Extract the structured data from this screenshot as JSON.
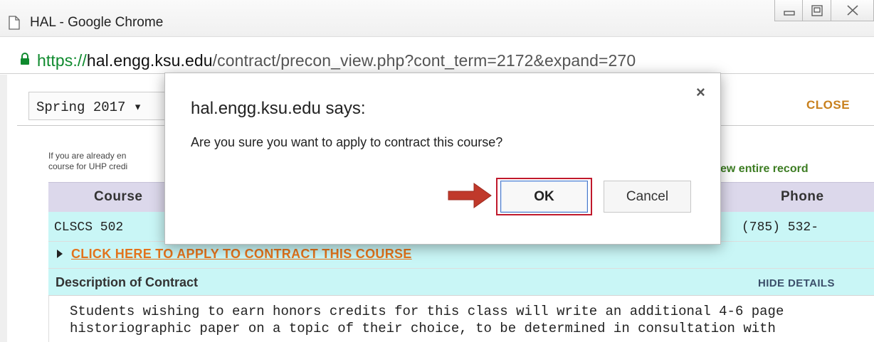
{
  "window": {
    "title": "HAL - Google Chrome",
    "url_scheme": "https://",
    "url_host": "hal.engg.ksu.edu",
    "url_path": "/contract/precon_view.php?cont_term=2172&expand=270"
  },
  "page": {
    "term_select_value": "Spring 2017",
    "term_select_arrow": "▾",
    "close_label": "CLOSE",
    "note_line1": "If you are already en",
    "note_line2": "course for UHP credi",
    "view_record_label": "ew entire record",
    "table": {
      "headers": {
        "course": "Course",
        "phone": "Phone"
      },
      "row": {
        "course": "CLSCS 502",
        "phone": "(785) 532-"
      }
    },
    "apply_link": "CLICK HERE TO APPLY TO CONTRACT THIS COURSE",
    "description_title": "Description of Contract",
    "hide_details_label": "HIDE DETAILS",
    "description_text": "Students wishing to earn honors credits for this class will write an additional 4-6 page\nhistoriographic paper on a topic of their choice, to be determined in consultation with"
  },
  "dialog": {
    "title": "hal.engg.ksu.edu says:",
    "message": "Are you sure you want to apply to contract this course?",
    "ok_label": "OK",
    "cancel_label": "Cancel",
    "close_glyph": "×",
    "highlight_color": "#c0192c",
    "arrow_color": "#c0392b"
  },
  "icons": [
    "page-icon",
    "minimize-icon",
    "maximize-icon",
    "close-window-icon",
    "lock-icon",
    "triangle-right-icon",
    "red-arrow-icon"
  ]
}
